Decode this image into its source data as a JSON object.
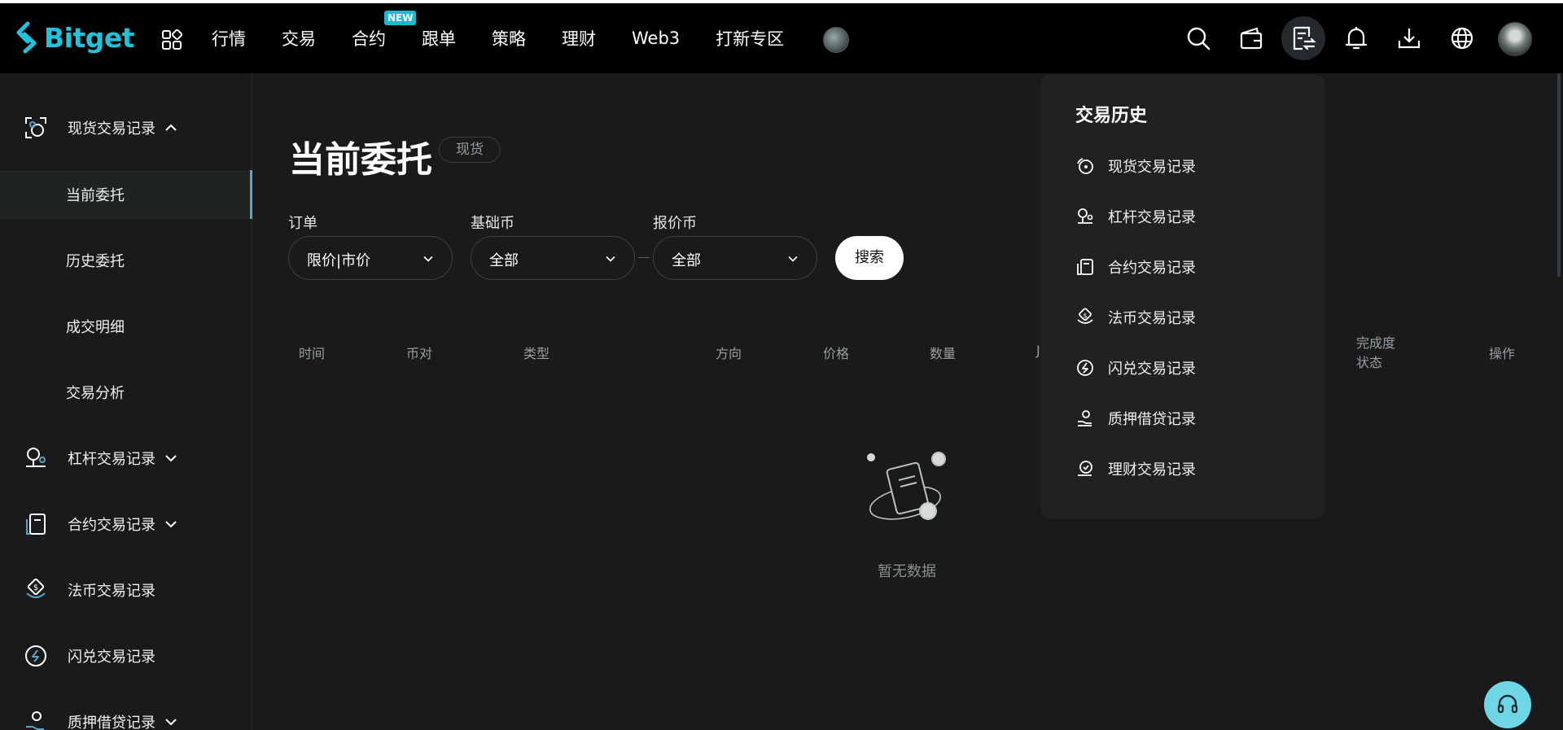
{
  "brand": {
    "name": "Bitget",
    "accent": "#1fc4dc"
  },
  "nav": {
    "items": [
      {
        "label": "行情"
      },
      {
        "label": "交易"
      },
      {
        "label": "合约",
        "badge": "NEW"
      },
      {
        "label": "跟单"
      },
      {
        "label": "策略"
      },
      {
        "label": "理财"
      },
      {
        "label": "Web3"
      },
      {
        "label": "打新专区"
      }
    ]
  },
  "header_icons": [
    "search-icon",
    "wallet-icon",
    "orders-icon",
    "bell-icon",
    "download-icon",
    "globe-icon"
  ],
  "sidebar": {
    "groups": [
      {
        "label": "现货交易记录",
        "icon": "spot-icon",
        "expanded": true,
        "children": [
          {
            "label": "当前委托",
            "active": true
          },
          {
            "label": "历史委托"
          },
          {
            "label": "成交明细"
          },
          {
            "label": "交易分析"
          }
        ]
      },
      {
        "label": "杠杆交易记录",
        "icon": "margin-icon",
        "expanded": false
      },
      {
        "label": "合约交易记录",
        "icon": "futures-icon",
        "expanded": false
      },
      {
        "label": "法币交易记录",
        "icon": "fiat-icon"
      },
      {
        "label": "闪兑交易记录",
        "icon": "swap-icon"
      },
      {
        "label": "质押借贷记录",
        "icon": "loan-icon",
        "expanded": false
      }
    ]
  },
  "main": {
    "title": "当前委托",
    "tag": "现货",
    "filters": {
      "order": {
        "label": "订单",
        "value": "限价|市价"
      },
      "base": {
        "label": "基础币",
        "value": "全部"
      },
      "quote": {
        "label": "报价币",
        "value": "全部"
      },
      "search_label": "搜索"
    },
    "table_headers": {
      "time": "时间",
      "pair": "币对",
      "type": "类型",
      "side": "方向",
      "price": "价格",
      "amount": "数量",
      "partial": "J",
      "fill_line1": "完成度",
      "fill_line2": "状态",
      "action": "操作"
    },
    "empty_text": "暂无数据"
  },
  "dropdown": {
    "title": "交易历史",
    "items": [
      {
        "label": "现货交易记录",
        "icon": "spot-icon"
      },
      {
        "label": "杠杆交易记录",
        "icon": "margin-icon"
      },
      {
        "label": "合约交易记录",
        "icon": "futures-icon"
      },
      {
        "label": "法币交易记录",
        "icon": "fiat-icon"
      },
      {
        "label": "闪兑交易记录",
        "icon": "swap-icon"
      },
      {
        "label": "质押借贷记录",
        "icon": "loan-icon"
      },
      {
        "label": "理财交易记录",
        "icon": "earn-icon"
      }
    ]
  }
}
